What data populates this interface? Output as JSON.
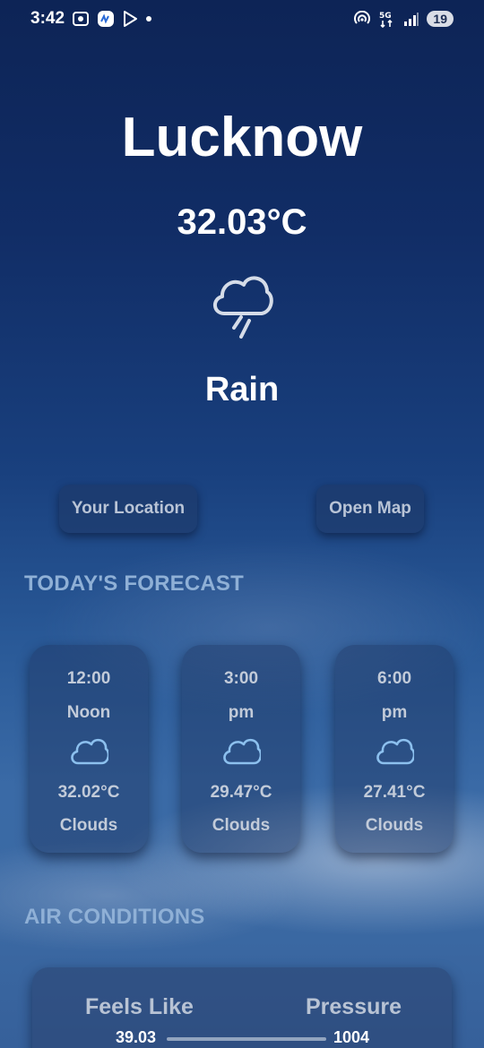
{
  "status_bar": {
    "time": "3:42",
    "battery": "19",
    "network": "5G"
  },
  "weather": {
    "city": "Lucknow",
    "temperature": "32.03°C",
    "condition": "Rain",
    "condition_icon": "rain-cloud-icon"
  },
  "buttons": {
    "your_location": "Your Location",
    "open_map": "Open Map"
  },
  "forecast": {
    "title": "TODAY'S FORECAST",
    "items": [
      {
        "time": "12:00",
        "period": "Noon",
        "icon": "cloud-icon",
        "temp": "32.02°C",
        "condition": "Clouds"
      },
      {
        "time": "3:00",
        "period": "pm",
        "icon": "cloud-icon",
        "temp": "29.47°C",
        "condition": "Clouds"
      },
      {
        "time": "6:00",
        "period": "pm",
        "icon": "cloud-icon",
        "temp": "27.41°C",
        "condition": "Clouds"
      }
    ]
  },
  "air_conditions": {
    "title": "AIR CONDITIONS",
    "feels_like_label": "Feels Like",
    "feels_like_value": "39.03",
    "pressure_label": "Pressure",
    "pressure_value": "1004"
  },
  "colors": {
    "accent_text": "#8fb0d6",
    "icon_blue": "#8cc0ee"
  }
}
